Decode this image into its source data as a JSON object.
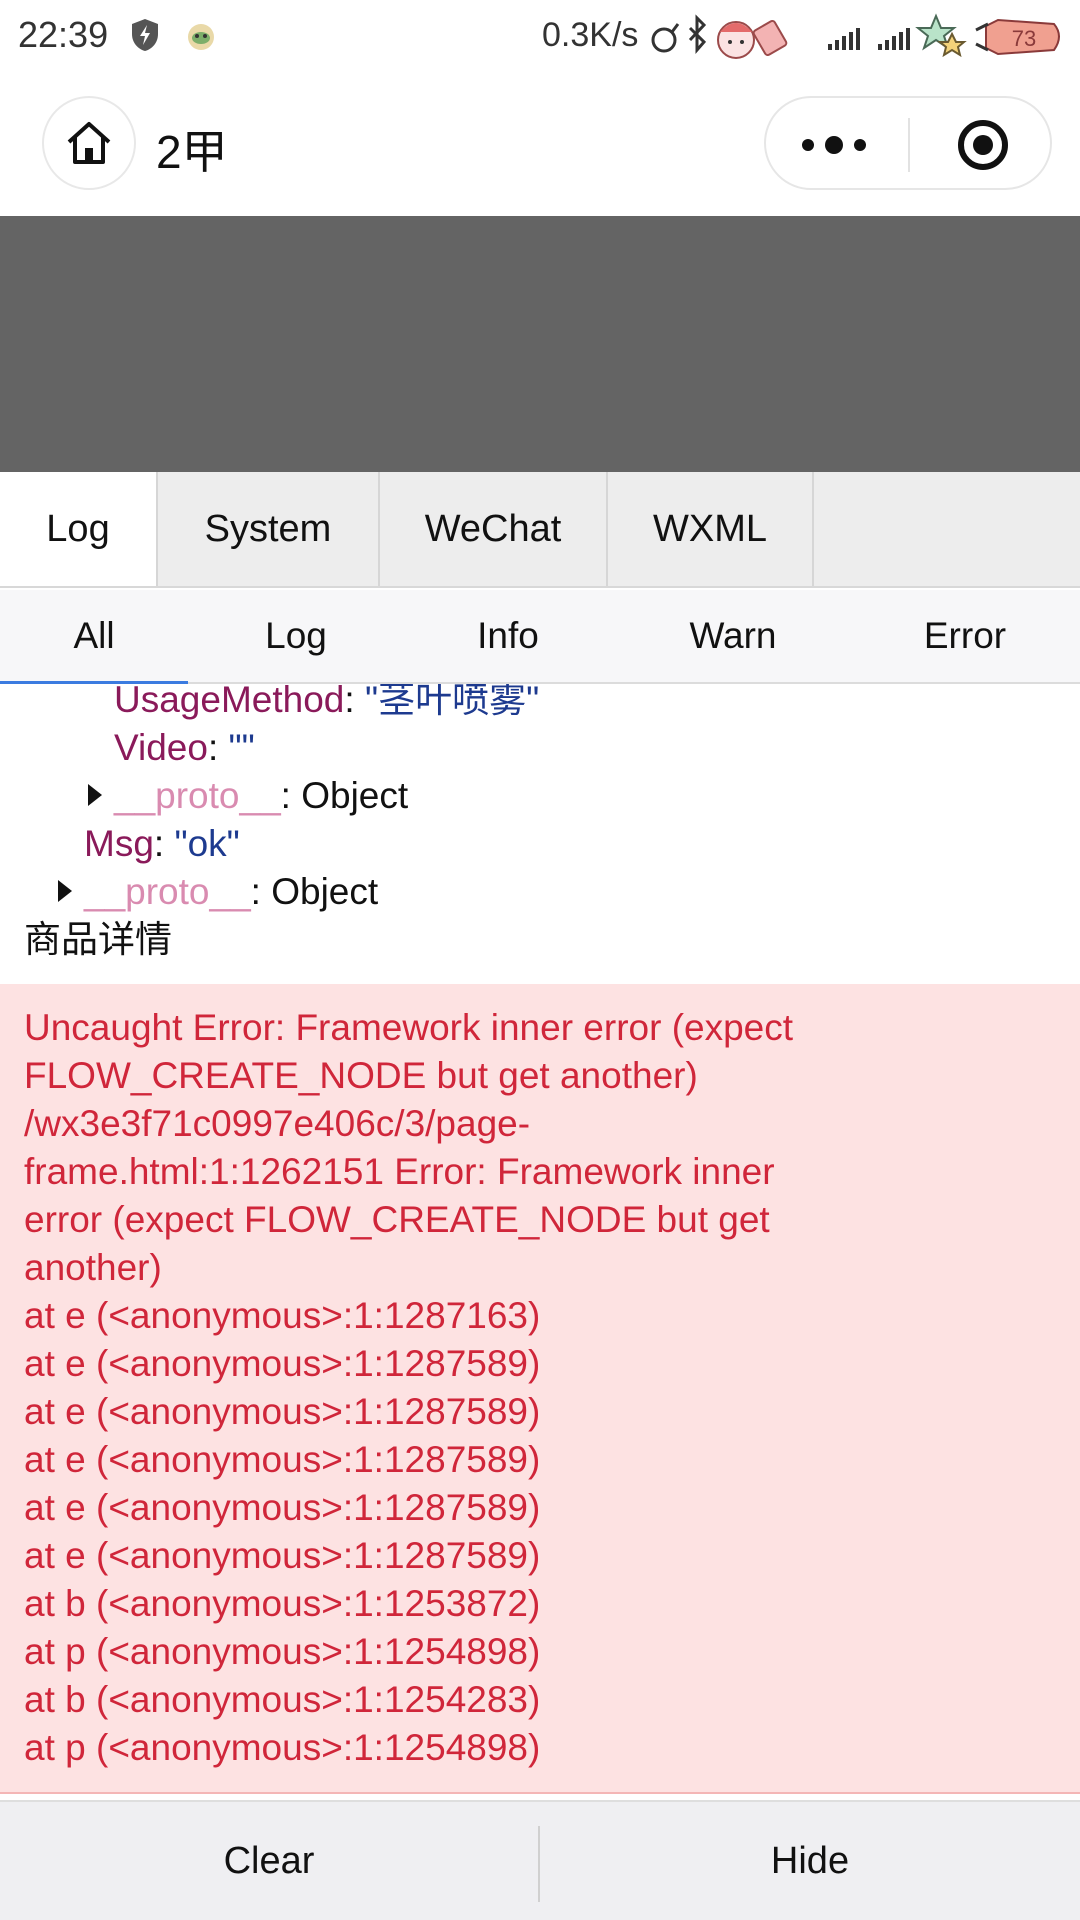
{
  "status_bar": {
    "time": "22:39",
    "speed": "0.3K/s",
    "battery": "73",
    "icons": [
      "shield-icon",
      "app-notification-icon",
      "alarm-icon",
      "bluetooth-icon",
      "sticker-icon",
      "signal-icon",
      "signal-icon",
      "star-icon",
      "battery-icon"
    ]
  },
  "nav": {
    "title": "2甲",
    "home_icon": "home-icon",
    "more_icon": "more-icon",
    "target_icon": "target-icon"
  },
  "vconsole": {
    "tabs": [
      "Log",
      "System",
      "WeChat",
      "WXML"
    ],
    "active_tab": "Log",
    "filters": [
      "All",
      "Log",
      "Info",
      "Warn",
      "Error"
    ],
    "active_filter": "All",
    "log_lines": [
      {
        "key": "UsageMethod",
        "sep": ": ",
        "value": "\"茎叶喷雾\""
      },
      {
        "key": "Video",
        "sep": ": ",
        "value": "\"\""
      },
      {
        "key": "__proto__",
        "sep": ": ",
        "value": "Object"
      },
      {
        "key": "Msg",
        "sep": ": ",
        "value": "\"ok\""
      },
      {
        "key": "__proto__",
        "sep": ": ",
        "value": "Object"
      },
      {
        "text": "商品详情"
      }
    ],
    "error_lines": [
      "Uncaught Error: Framework inner error (expect",
      "FLOW_CREATE_NODE but get another)",
      "/wx3e3f71c0997e406c/3/page-",
      "frame.html:1:1262151 Error: Framework inner",
      "error (expect FLOW_CREATE_NODE but get",
      "another)",
      "at e (<anonymous>:1:1287163)",
      "at e (<anonymous>:1:1287589)",
      "at e (<anonymous>:1:1287589)",
      "at e (<anonymous>:1:1287589)",
      "at e (<anonymous>:1:1287589)",
      "at e (<anonymous>:1:1287589)",
      "at b (<anonymous>:1:1253872)",
      "at p (<anonymous>:1:1254898)",
      "at b (<anonymous>:1:1254283)",
      "at p (<anonymous>:1:1254898)"
    ],
    "bottom_buttons": {
      "clear": "Clear",
      "hide": "Hide"
    }
  }
}
